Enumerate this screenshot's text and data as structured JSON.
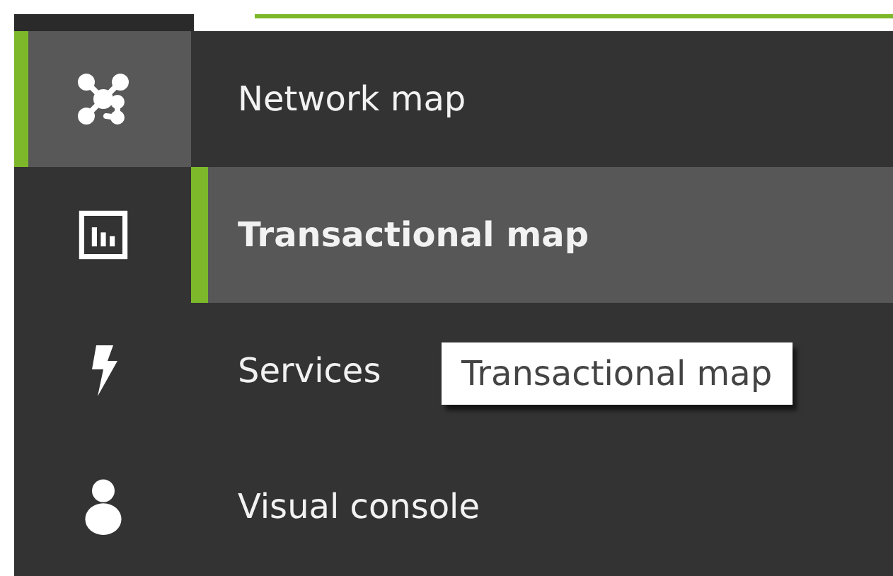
{
  "menu": [
    {
      "label": "Network map",
      "hovered": true,
      "selected": false
    },
    {
      "label": "Transactional map",
      "hovered": false,
      "selected": true
    },
    {
      "label": "Services",
      "hovered": false,
      "selected": false,
      "tooltip": "Transactional map"
    },
    {
      "label": "Visual console",
      "hovered": false,
      "selected": false
    }
  ]
}
